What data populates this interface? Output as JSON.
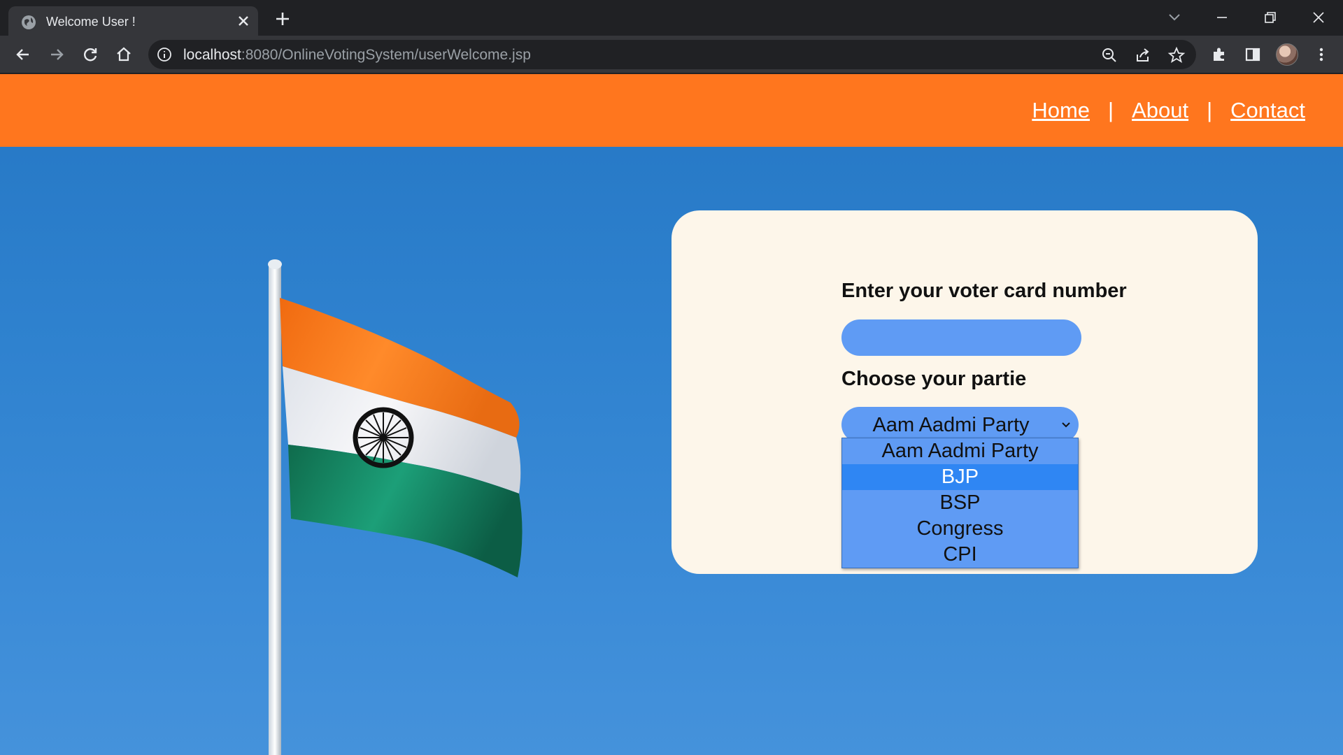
{
  "browser": {
    "tab_title": "Welcome User !",
    "url_host": "localhost",
    "url_rest": ":8080/OnlineVotingSystem/userWelcome.jsp"
  },
  "nav": {
    "home": "Home",
    "separator": "|",
    "about": "About",
    "contact": "Contact"
  },
  "form": {
    "voter_label": "Enter your voter card number",
    "voter_value": "",
    "party_label": "Choose your partie",
    "selected_party": "Aam Aadmi Party",
    "options": [
      "Aam Aadmi Party",
      "BJP",
      "BSP",
      "Congress",
      "CPI"
    ],
    "highlighted_option": "BJP"
  },
  "colors": {
    "navbar": "#ff761e",
    "card": "#fdf6ea",
    "field": "#5f9bf4",
    "highlight": "#2f86f3",
    "sky": "#2f82cf"
  }
}
